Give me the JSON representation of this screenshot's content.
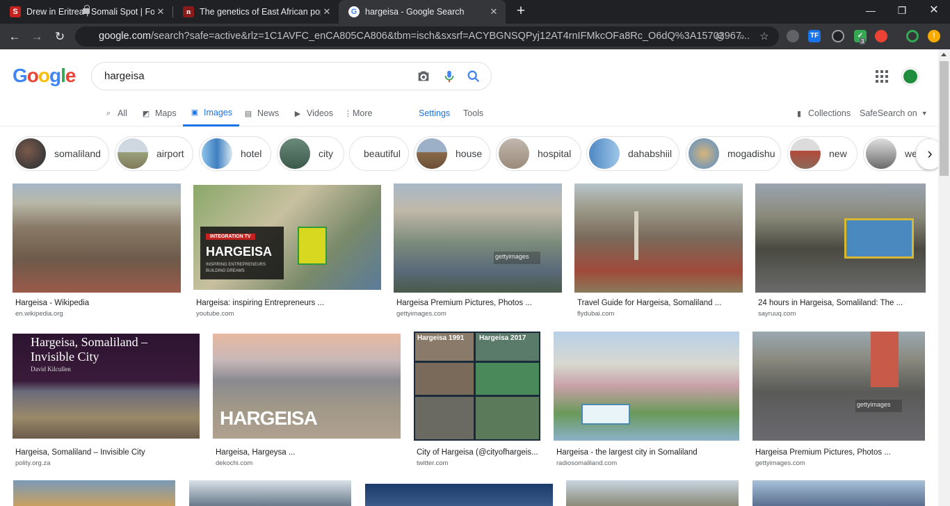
{
  "browser": {
    "tabs": [
      {
        "title": "Drew in Eritrea | Somali Spot | Fo",
        "favicon": "somalispot-icon",
        "active": false
      },
      {
        "title": "The genetics of East African popu",
        "favicon": "n-icon",
        "active": false
      },
      {
        "title": "hargeisa - Google Search",
        "favicon": "google-icon",
        "active": true
      }
    ],
    "new_tab": "+",
    "url_host": "google.com",
    "url_path": "/search?safe=active&rlz=1C1AVFC_enCA805CA806&tbm=isch&sxsrf=ACYBGNSQPyj12AT4rnIFMkcOFa8Rc_O6dQ%3A15703967...",
    "extension_badge": "3"
  },
  "google": {
    "logo": "Google",
    "query": "hargeisa",
    "nav": [
      {
        "label": "All",
        "icon": "search-icon"
      },
      {
        "label": "Maps",
        "icon": "map-icon"
      },
      {
        "label": "Images",
        "icon": "image-icon",
        "active": true
      },
      {
        "label": "News",
        "icon": "news-icon"
      },
      {
        "label": "Videos",
        "icon": "video-icon"
      },
      {
        "label": "More",
        "icon": "more-vert-icon"
      }
    ],
    "settings": "Settings",
    "tools": "Tools",
    "collections": "Collections",
    "safesearch": "SafeSearch on"
  },
  "chips": [
    "somaliland",
    "airport",
    "hotel",
    "city",
    "beautiful",
    "house",
    "hospital",
    "dahabshiil",
    "mogadishu",
    "new",
    "we"
  ],
  "results_row1": [
    {
      "caption": "Hargeisa - Wikipedia",
      "source": "en.wikipedia.org"
    },
    {
      "caption": "Hargeisa: inspiring Entrepreneurs ...",
      "source": "youtube.com",
      "overlay_tag": "INTEGRATION TV",
      "overlay_title": "HARGEISA",
      "overlay_sub1": "INSPIRING ENTREPRENEURS",
      "overlay_sub2": "BUILDING DREAMS"
    },
    {
      "caption": "Hargeisa Premium Pictures, Photos ...",
      "source": "gettyimages.com",
      "watermark": "gettyimages"
    },
    {
      "caption": "Travel Guide for Hargeisa, Somaliland ...",
      "source": "flydubai.com"
    },
    {
      "caption": "24 hours in Hargeisa, Somaliland: The ...",
      "source": "sayruuq.com"
    }
  ],
  "results_row2": [
    {
      "caption": "Hargeisa, Somaliland – Invisible City",
      "source": "polity.org.za",
      "overlay_title": "Hargeisa, Somaliland –\nInvisible City",
      "overlay_author": "David Kilcullen"
    },
    {
      "caption": "Hargeisa, Hargeysa ...",
      "source": "dekochi.com",
      "overlay_title": "HARGEISA"
    },
    {
      "caption": "City of Hargeisa (@cityofhargeis...",
      "source": "twitter.com",
      "label_left": "Hargeisa 1991",
      "label_right": "Hargeisa 2017"
    },
    {
      "caption": "Hargeisa - the largest city in Somaliland",
      "source": "radiosomaliland.com"
    },
    {
      "caption": "Hargeisa Premium Pictures, Photos ...",
      "source": "gettyimages.com",
      "watermark": "gettyimages"
    }
  ],
  "colors": {
    "accent": "#1a73e8",
    "chrome_dark": "#202124",
    "chrome_toolbar": "#35363a"
  }
}
